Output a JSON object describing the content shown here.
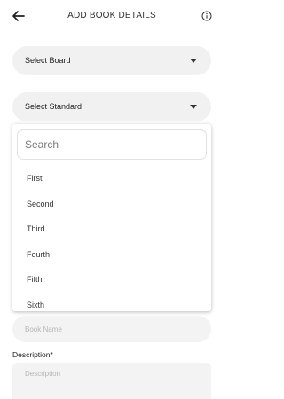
{
  "header": {
    "title": "ADD BOOK DETAILS",
    "back_icon": "arrow-left-icon",
    "info_icon": "info-icon"
  },
  "board_select": {
    "label": "Select Board"
  },
  "standard_select": {
    "label": "Select Standard",
    "expanded": true
  },
  "dropdown": {
    "search_placeholder": "Search",
    "options": [
      "First",
      "Second",
      "Third",
      "Fourth",
      "Fifth",
      "Sixth"
    ]
  },
  "book_name": {
    "placeholder": "Book Name"
  },
  "description": {
    "label": "Description*",
    "placeholder": "Description"
  },
  "colors": {
    "field_bg": "#f1f1f1",
    "placeholder": "#b5b5b5",
    "text": "#222222"
  }
}
